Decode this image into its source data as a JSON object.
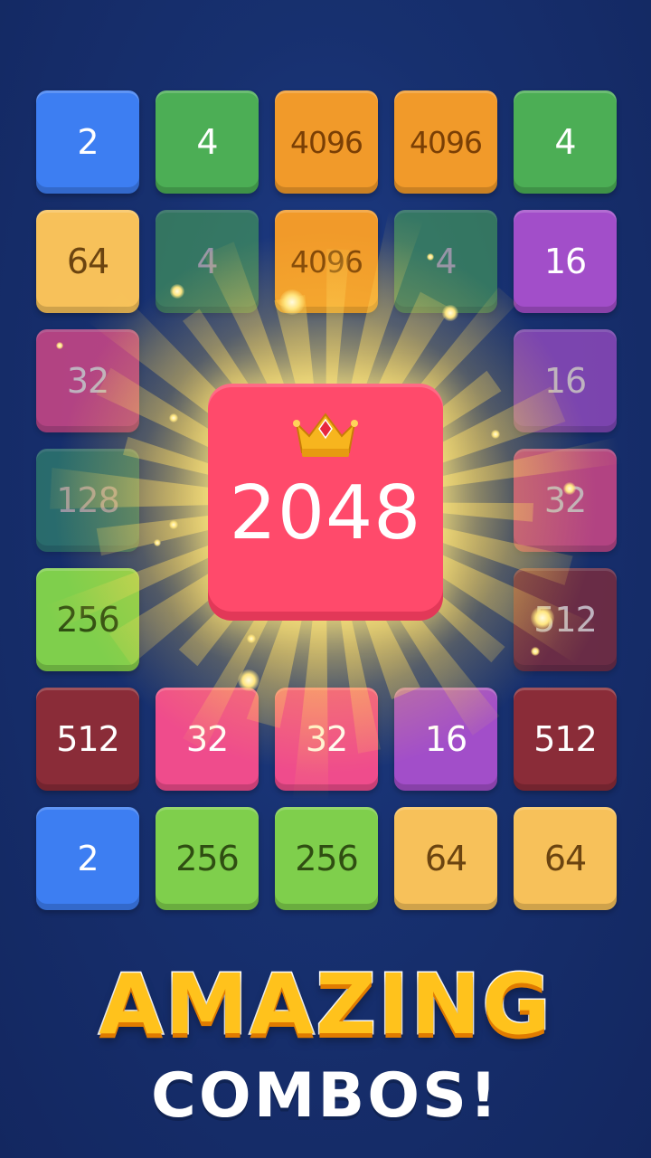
{
  "board": {
    "tiles": [
      {
        "value": "2",
        "row": 0,
        "col": 0,
        "bg": "#3d7ef2",
        "fg": "#ffffff"
      },
      {
        "value": "4",
        "row": 0,
        "col": 1,
        "bg": "#4cae55",
        "fg": "#ffffff"
      },
      {
        "value": "4096",
        "row": 0,
        "col": 2,
        "bg": "#f19a2a",
        "fg": "#7a3f05"
      },
      {
        "value": "4096",
        "row": 0,
        "col": 3,
        "bg": "#f19a2a",
        "fg": "#7a3f05"
      },
      {
        "value": "4",
        "row": 0,
        "col": 4,
        "bg": "#4cae55",
        "fg": "#ffffff"
      },
      {
        "value": "64",
        "row": 1,
        "col": 0,
        "bg": "#f7c15a",
        "fg": "#6b4410"
      },
      {
        "value": "4",
        "row": 1,
        "col": 1,
        "bg": "#4cae55",
        "fg": "#ffe3d0",
        "dim": true
      },
      {
        "value": "4096",
        "row": 1,
        "col": 2,
        "bg": "#f19a2a",
        "fg": "#7a3f05"
      },
      {
        "value": "4",
        "row": 1,
        "col": 3,
        "bg": "#4cae55",
        "fg": "#ffe3d0",
        "dim": true
      },
      {
        "value": "16",
        "row": 1,
        "col": 4,
        "bg": "#a24ec9",
        "fg": "#ffffff"
      },
      {
        "value": "32",
        "row": 2,
        "col": 0,
        "bg": "#ef4c8c",
        "fg": "#ffe6e0",
        "dim2": true
      },
      {
        "value": "16",
        "row": 2,
        "col": 4,
        "bg": "#a24ec9",
        "fg": "#ffe6e0",
        "dim2": true
      },
      {
        "value": "128",
        "row": 3,
        "col": 0,
        "bg": "#3a9e6f",
        "fg": "#ffe6d6",
        "dim": true
      },
      {
        "value": "32",
        "row": 3,
        "col": 4,
        "bg": "#ef4c8c",
        "fg": "#ffe6e0",
        "dim2": true
      },
      {
        "value": "256",
        "row": 4,
        "col": 0,
        "bg": "#7fcf4c",
        "fg": "#2f4e12"
      },
      {
        "value": "512",
        "row": 4,
        "col": 4,
        "bg": "#8a2c38",
        "fg": "#ffe6e0",
        "dim2": true
      },
      {
        "value": "512",
        "row": 5,
        "col": 0,
        "bg": "#8a2c38",
        "fg": "#ffffff"
      },
      {
        "value": "32",
        "row": 5,
        "col": 1,
        "bg": "#ef4c8c",
        "fg": "#ffffff"
      },
      {
        "value": "32",
        "row": 5,
        "col": 2,
        "bg": "#ef4c8c",
        "fg": "#ffffff"
      },
      {
        "value": "16",
        "row": 5,
        "col": 3,
        "bg": "#a24ec9",
        "fg": "#ffffff"
      },
      {
        "value": "512",
        "row": 5,
        "col": 4,
        "bg": "#8a2c38",
        "fg": "#ffffff"
      },
      {
        "value": "2",
        "row": 6,
        "col": 0,
        "bg": "#3d7ef2",
        "fg": "#ffffff"
      },
      {
        "value": "256",
        "row": 6,
        "col": 1,
        "bg": "#7fcf4c",
        "fg": "#2f4e12"
      },
      {
        "value": "256",
        "row": 6,
        "col": 2,
        "bg": "#7fcf4c",
        "fg": "#2f4e12"
      },
      {
        "value": "64",
        "row": 6,
        "col": 3,
        "bg": "#f7c15a",
        "fg": "#6b4410"
      },
      {
        "value": "64",
        "row": 6,
        "col": 4,
        "bg": "#f7c15a",
        "fg": "#6b4410"
      }
    ]
  },
  "hero": {
    "value": "2048",
    "icon": "crown-icon",
    "color": "#ff4a6b"
  },
  "promo": {
    "headline": "AMAZING",
    "subline": "COMBOS!"
  },
  "colors": {
    "background": "#17306f",
    "glow": "#fff4b0",
    "headline": "#ffc21c"
  }
}
